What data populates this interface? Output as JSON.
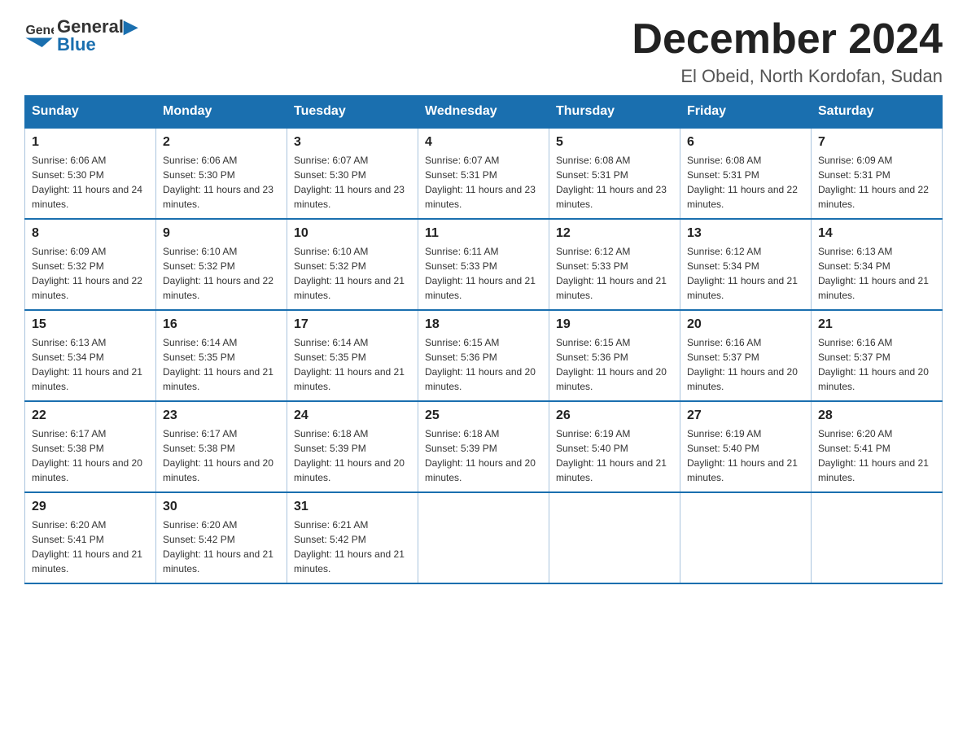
{
  "header": {
    "logo_text_general": "General",
    "logo_text_blue": "Blue",
    "month_title": "December 2024",
    "subtitle": "El Obeid, North Kordofan, Sudan"
  },
  "days_of_week": [
    "Sunday",
    "Monday",
    "Tuesday",
    "Wednesday",
    "Thursday",
    "Friday",
    "Saturday"
  ],
  "weeks": [
    [
      {
        "day": "1",
        "sunrise": "6:06 AM",
        "sunset": "5:30 PM",
        "daylight": "11 hours and 24 minutes."
      },
      {
        "day": "2",
        "sunrise": "6:06 AM",
        "sunset": "5:30 PM",
        "daylight": "11 hours and 23 minutes."
      },
      {
        "day": "3",
        "sunrise": "6:07 AM",
        "sunset": "5:30 PM",
        "daylight": "11 hours and 23 minutes."
      },
      {
        "day": "4",
        "sunrise": "6:07 AM",
        "sunset": "5:31 PM",
        "daylight": "11 hours and 23 minutes."
      },
      {
        "day": "5",
        "sunrise": "6:08 AM",
        "sunset": "5:31 PM",
        "daylight": "11 hours and 23 minutes."
      },
      {
        "day": "6",
        "sunrise": "6:08 AM",
        "sunset": "5:31 PM",
        "daylight": "11 hours and 22 minutes."
      },
      {
        "day": "7",
        "sunrise": "6:09 AM",
        "sunset": "5:31 PM",
        "daylight": "11 hours and 22 minutes."
      }
    ],
    [
      {
        "day": "8",
        "sunrise": "6:09 AM",
        "sunset": "5:32 PM",
        "daylight": "11 hours and 22 minutes."
      },
      {
        "day": "9",
        "sunrise": "6:10 AM",
        "sunset": "5:32 PM",
        "daylight": "11 hours and 22 minutes."
      },
      {
        "day": "10",
        "sunrise": "6:10 AM",
        "sunset": "5:32 PM",
        "daylight": "11 hours and 21 minutes."
      },
      {
        "day": "11",
        "sunrise": "6:11 AM",
        "sunset": "5:33 PM",
        "daylight": "11 hours and 21 minutes."
      },
      {
        "day": "12",
        "sunrise": "6:12 AM",
        "sunset": "5:33 PM",
        "daylight": "11 hours and 21 minutes."
      },
      {
        "day": "13",
        "sunrise": "6:12 AM",
        "sunset": "5:34 PM",
        "daylight": "11 hours and 21 minutes."
      },
      {
        "day": "14",
        "sunrise": "6:13 AM",
        "sunset": "5:34 PM",
        "daylight": "11 hours and 21 minutes."
      }
    ],
    [
      {
        "day": "15",
        "sunrise": "6:13 AM",
        "sunset": "5:34 PM",
        "daylight": "11 hours and 21 minutes."
      },
      {
        "day": "16",
        "sunrise": "6:14 AM",
        "sunset": "5:35 PM",
        "daylight": "11 hours and 21 minutes."
      },
      {
        "day": "17",
        "sunrise": "6:14 AM",
        "sunset": "5:35 PM",
        "daylight": "11 hours and 21 minutes."
      },
      {
        "day": "18",
        "sunrise": "6:15 AM",
        "sunset": "5:36 PM",
        "daylight": "11 hours and 20 minutes."
      },
      {
        "day": "19",
        "sunrise": "6:15 AM",
        "sunset": "5:36 PM",
        "daylight": "11 hours and 20 minutes."
      },
      {
        "day": "20",
        "sunrise": "6:16 AM",
        "sunset": "5:37 PM",
        "daylight": "11 hours and 20 minutes."
      },
      {
        "day": "21",
        "sunrise": "6:16 AM",
        "sunset": "5:37 PM",
        "daylight": "11 hours and 20 minutes."
      }
    ],
    [
      {
        "day": "22",
        "sunrise": "6:17 AM",
        "sunset": "5:38 PM",
        "daylight": "11 hours and 20 minutes."
      },
      {
        "day": "23",
        "sunrise": "6:17 AM",
        "sunset": "5:38 PM",
        "daylight": "11 hours and 20 minutes."
      },
      {
        "day": "24",
        "sunrise": "6:18 AM",
        "sunset": "5:39 PM",
        "daylight": "11 hours and 20 minutes."
      },
      {
        "day": "25",
        "sunrise": "6:18 AM",
        "sunset": "5:39 PM",
        "daylight": "11 hours and 20 minutes."
      },
      {
        "day": "26",
        "sunrise": "6:19 AM",
        "sunset": "5:40 PM",
        "daylight": "11 hours and 21 minutes."
      },
      {
        "day": "27",
        "sunrise": "6:19 AM",
        "sunset": "5:40 PM",
        "daylight": "11 hours and 21 minutes."
      },
      {
        "day": "28",
        "sunrise": "6:20 AM",
        "sunset": "5:41 PM",
        "daylight": "11 hours and 21 minutes."
      }
    ],
    [
      {
        "day": "29",
        "sunrise": "6:20 AM",
        "sunset": "5:41 PM",
        "daylight": "11 hours and 21 minutes."
      },
      {
        "day": "30",
        "sunrise": "6:20 AM",
        "sunset": "5:42 PM",
        "daylight": "11 hours and 21 minutes."
      },
      {
        "day": "31",
        "sunrise": "6:21 AM",
        "sunset": "5:42 PM",
        "daylight": "11 hours and 21 minutes."
      },
      null,
      null,
      null,
      null
    ]
  ]
}
